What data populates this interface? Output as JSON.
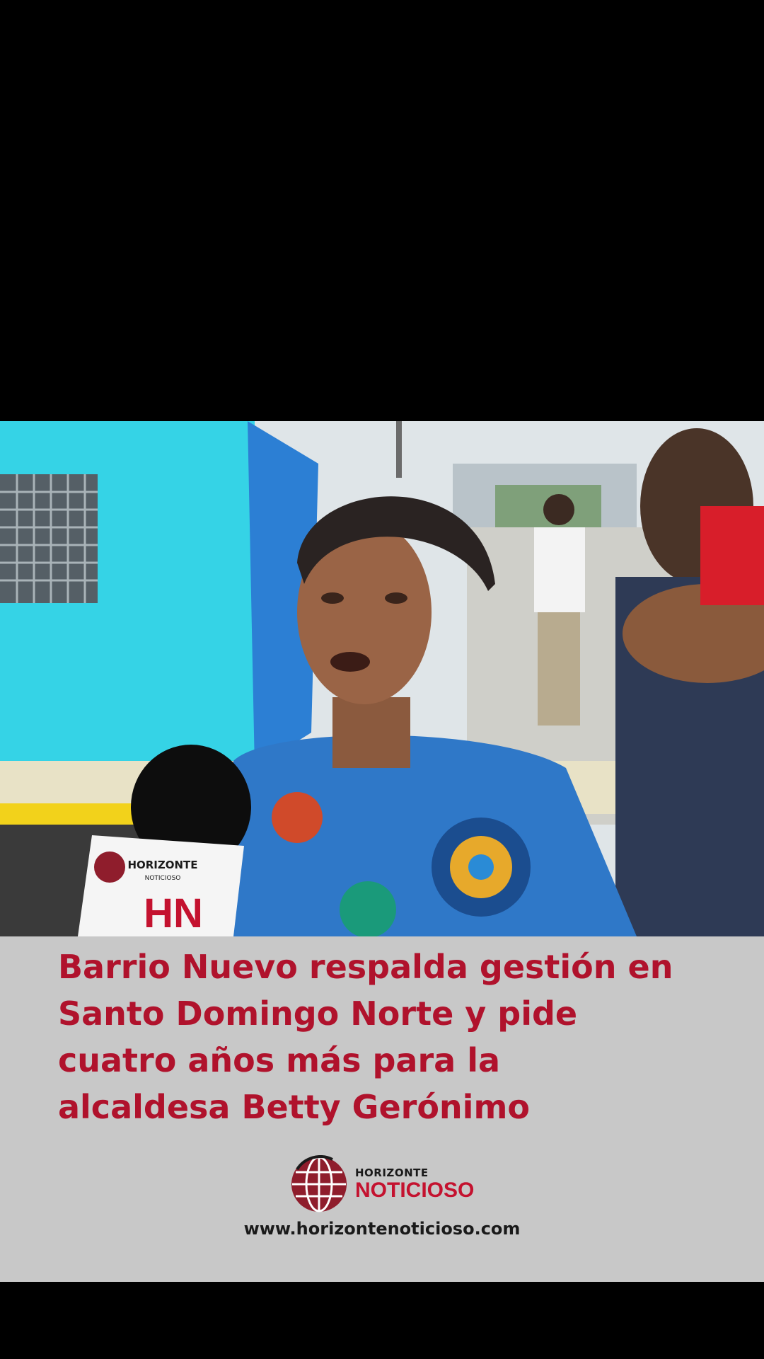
{
  "video": {
    "mic_brand_top": "HORIZONTE",
    "mic_brand_sub": "NOTICIOSO",
    "mic_brand_letters": "HN"
  },
  "caption": {
    "headline_lines": [
      "Barrio Nuevo respalda gestión en",
      "Santo Domingo Norte y pide",
      "cuatro años más para la",
      "alcaldesa Betty Gerónimo"
    ],
    "logo_icon": "globe-icon",
    "brand_top": "HORIZONTE",
    "brand_bottom": "NOTICIOSO",
    "url": "www.horizontenoticioso.com"
  },
  "colors": {
    "headline": "#b0122c",
    "panel": "#c8c8c8",
    "brand_red": "#c4122f",
    "background": "#000000"
  }
}
